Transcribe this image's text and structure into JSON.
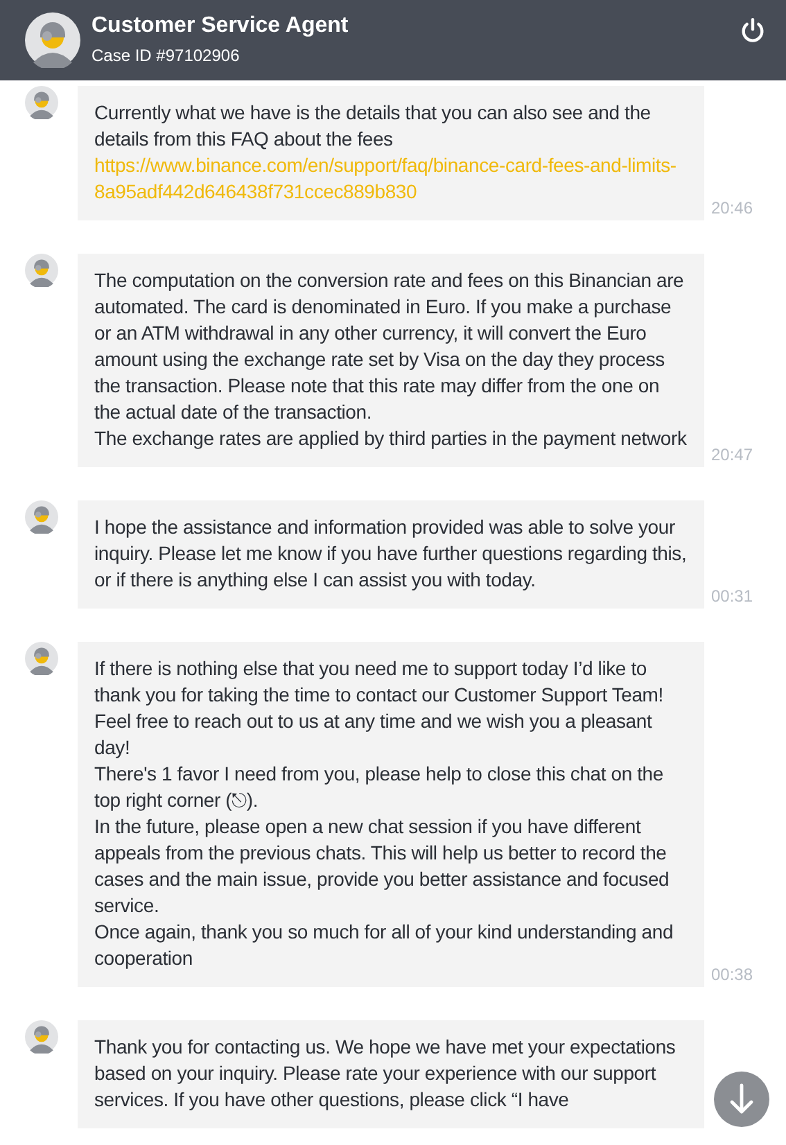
{
  "header": {
    "title": "Customer Service Agent",
    "subtitle": "Case ID #97102906"
  },
  "messages": [
    {
      "parts": [
        {
          "kind": "text",
          "text": "Currently what we have is the details that you can also see and the details from this FAQ about the fees"
        },
        {
          "kind": "link",
          "text": "https://www.binance.com/en/support/faq/binance-card-fees-and-limits-8a95adf442d646438f731ccec889b830"
        }
      ],
      "time": "20:46"
    },
    {
      "parts": [
        {
          "kind": "text",
          "text": "The computation on the conversion rate and fees on this Binancian are automated. The card is denominated in Euro. If you make a purchase or an ATM withdrawal in any other currency, it will convert the Euro amount using the exchange rate set by Visa on the day they process the transaction. Please note that this rate may differ from the one on the actual date of the transaction."
        },
        {
          "kind": "text",
          "text": "The exchange rates are applied by third parties in the payment network"
        }
      ],
      "time": "20:47"
    },
    {
      "parts": [
        {
          "kind": "text",
          "text": "I hope the assistance and information provided was able to solve your inquiry. Please let me know if you have further questions regarding this, or if there is anything else I can assist you with today."
        }
      ],
      "time": "00:31"
    },
    {
      "parts": [
        {
          "kind": "text",
          "text": "If there is nothing else that you need me to support today I’d like to thank you for taking the time to contact our Customer Support Team! Feel free to reach out to us at any time and we wish you a pleasant day!"
        },
        {
          "kind": "text",
          "text": "There's 1 favor I need from you, please help to close this chat on the top right corner (⎋)."
        },
        {
          "kind": "text",
          "text": "In the future, please open a new chat session if you have different appeals from the previous chats. This will help us better to record the cases and the main issue, provide you better assistance and focused service."
        },
        {
          "kind": "text",
          "text": "Once again, thank you so much for all of your kind understanding and cooperation"
        }
      ],
      "time": "00:38"
    },
    {
      "parts": [
        {
          "kind": "text",
          "text": "Thank you for contacting us. We hope we have met your expectations based on your inquiry. Please rate your experience with our support services. If you have other questions, please click “I have"
        }
      ]
    }
  ]
}
